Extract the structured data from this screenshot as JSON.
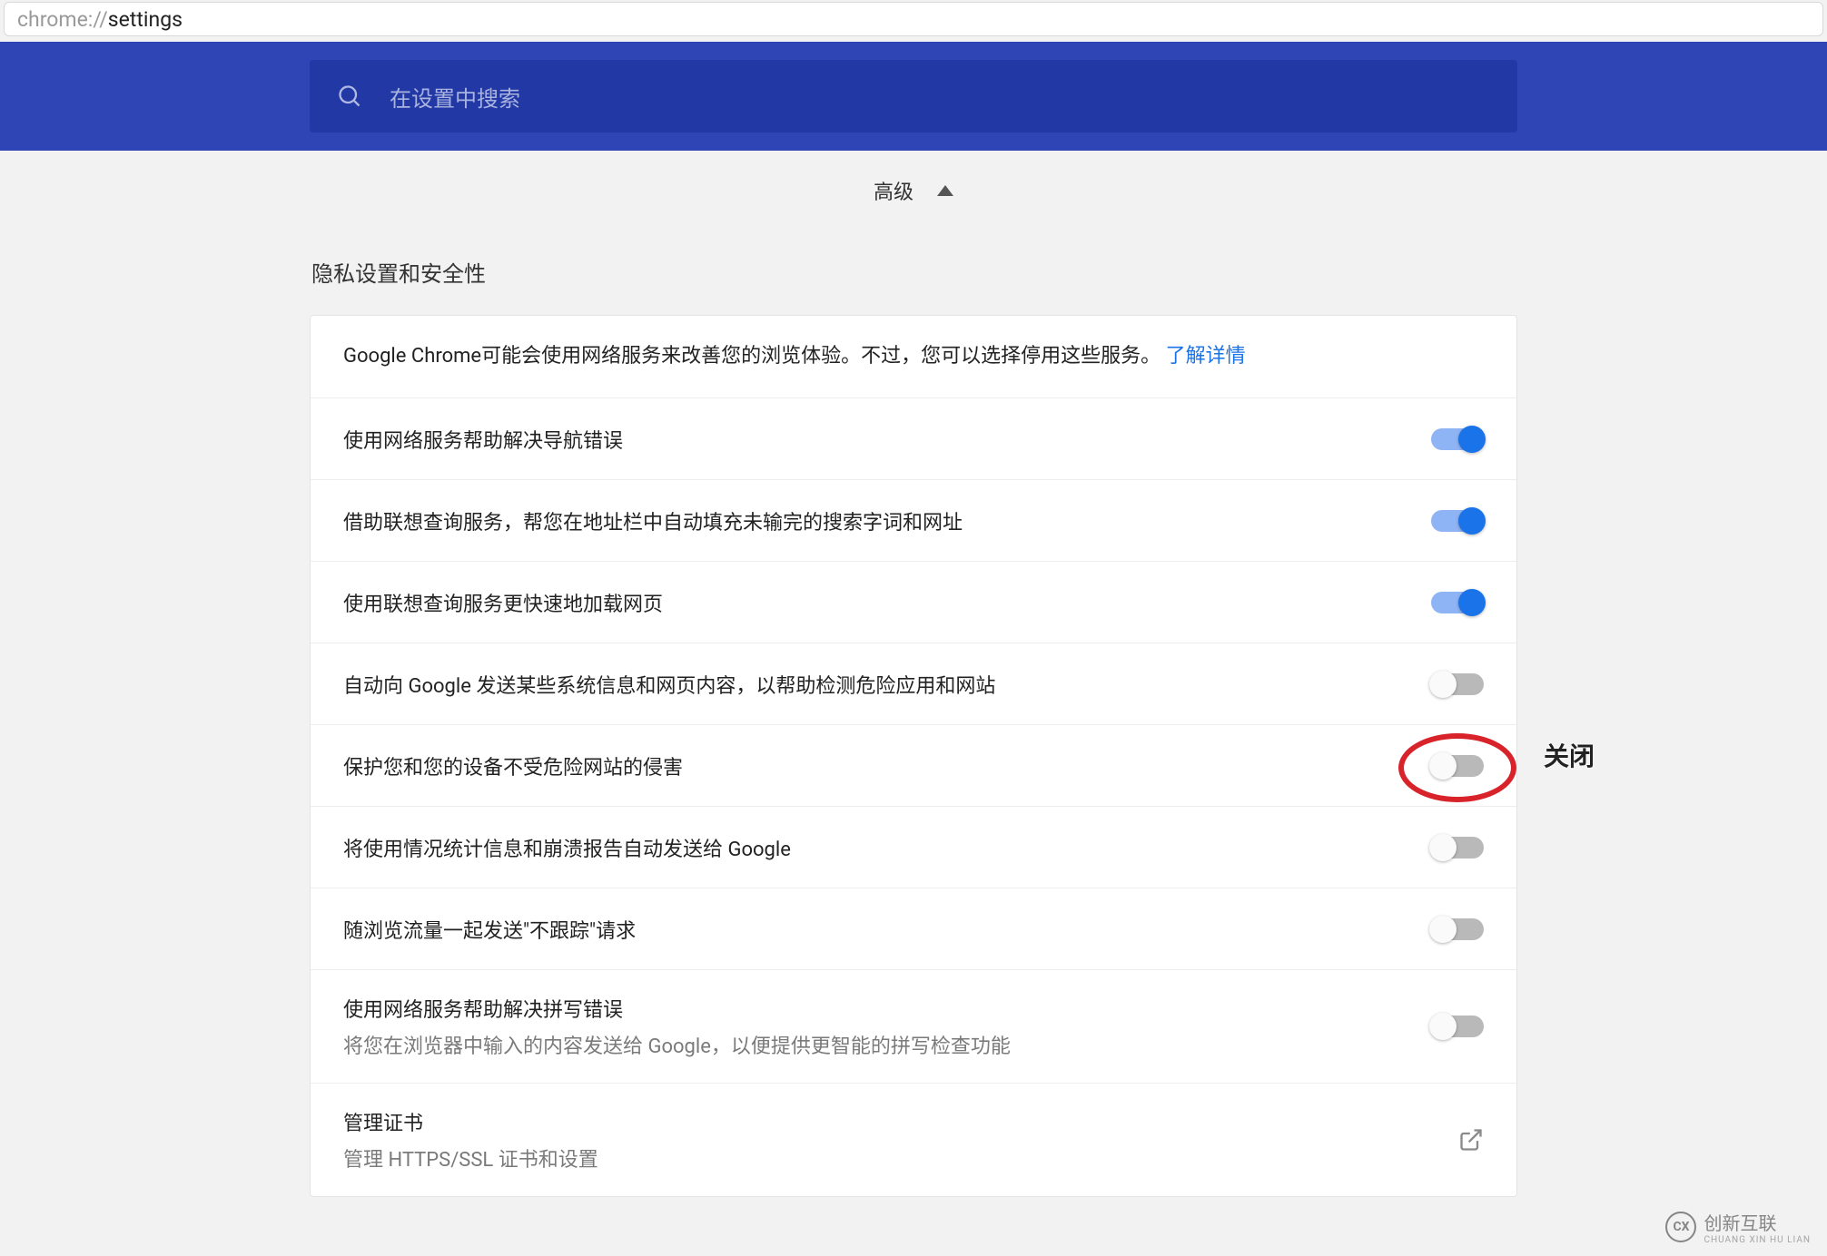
{
  "address_bar": {
    "prefix": "chrome://",
    "path": "settings"
  },
  "header": {
    "search_placeholder": "在设置中搜索"
  },
  "advanced": {
    "label": "高级"
  },
  "section": {
    "title": "隐私设置和安全性",
    "intro_text": "Google Chrome可能会使用网络服务来改善您的浏览体验。不过，您可以选择停用这些服务。",
    "intro_link": "了解详情",
    "items": [
      {
        "label": "使用网络服务帮助解决导航错误",
        "sub": "",
        "enabled": true
      },
      {
        "label": "借助联想查询服务，帮您在地址栏中自动填充未输完的搜索字词和网址",
        "sub": "",
        "enabled": true
      },
      {
        "label": "使用联想查询服务更快速地加载网页",
        "sub": "",
        "enabled": true
      },
      {
        "label": "自动向 Google 发送某些系统信息和网页内容，以帮助检测危险应用和网站",
        "sub": "",
        "enabled": false
      },
      {
        "label": "保护您和您的设备不受危险网站的侵害",
        "sub": "",
        "enabled": false,
        "highlight": true
      },
      {
        "label": "将使用情况统计信息和崩溃报告自动发送给 Google",
        "sub": "",
        "enabled": false
      },
      {
        "label": "随浏览流量一起发送\"不跟踪\"请求",
        "sub": "",
        "enabled": false
      },
      {
        "label": "使用网络服务帮助解决拼写错误",
        "sub": "将您在浏览器中输入的内容发送给 Google，以便提供更智能的拼写检查功能",
        "enabled": false
      }
    ],
    "cert": {
      "label": "管理证书",
      "sub": "管理 HTTPS/SSL 证书和设置"
    }
  },
  "annotation": {
    "label": "关闭"
  },
  "watermark": {
    "text": "创新互联",
    "sub": "CHUANG XIN HU LIAN",
    "badge": "CX"
  },
  "colors": {
    "header_bg": "#2f45b6",
    "search_bg": "#2238a4",
    "link": "#1a73e8",
    "toggle_on_track": "#8fb4f5",
    "toggle_on_knob": "#1a73e8",
    "annotation": "#d8232a"
  }
}
